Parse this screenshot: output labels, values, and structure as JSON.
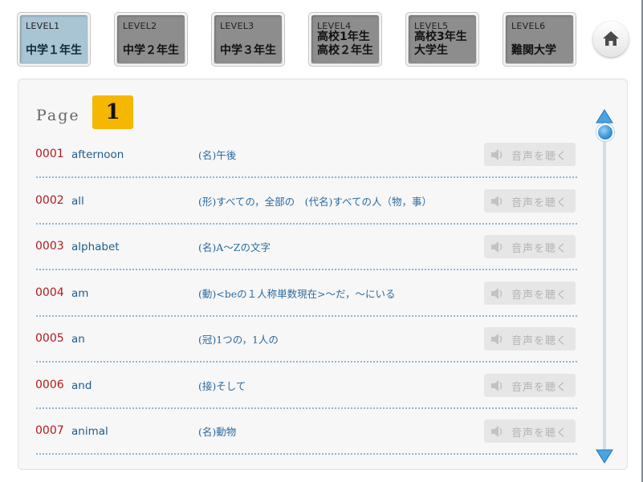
{
  "levels": [
    {
      "code": "LEVEL1",
      "name": "中学１年生",
      "active": true
    },
    {
      "code": "LEVEL2",
      "name": "中学２年生",
      "active": false
    },
    {
      "code": "LEVEL3",
      "name": "中学３年生",
      "active": false
    },
    {
      "code": "LEVEL4",
      "name": "高校1年生\n高校２年生",
      "active": false
    },
    {
      "code": "LEVEL5",
      "name": "高校3年生\n大学生",
      "active": false
    },
    {
      "code": "LEVEL6",
      "name": "難関大学",
      "active": false
    }
  ],
  "page": {
    "label": "Page",
    "number": "1"
  },
  "audio_label": "音声を聴く",
  "words": [
    {
      "num": "0001",
      "word": "afternoon",
      "meaning": "(名)午後"
    },
    {
      "num": "0002",
      "word": "all",
      "meaning": "(形)すべての，全部の　(代名)すべての人（物，事）"
    },
    {
      "num": "0003",
      "word": "alphabet",
      "meaning": "(名)A〜Zの文字"
    },
    {
      "num": "0004",
      "word": "am",
      "meaning": "(動)<beの１人称単数現在>〜だ，〜にいる"
    },
    {
      "num": "0005",
      "word": "an",
      "meaning": "(冠)1つの，1人の"
    },
    {
      "num": "0006",
      "word": "and",
      "meaning": "(接)そして"
    },
    {
      "num": "0007",
      "word": "animal",
      "meaning": "(名)動物"
    }
  ],
  "colors": {
    "accent": "#f5b700",
    "active_level": "#a9c4d3",
    "inactive_level": "#8d8d8d",
    "number": "#b11a1a",
    "word": "#1b5d8c"
  }
}
